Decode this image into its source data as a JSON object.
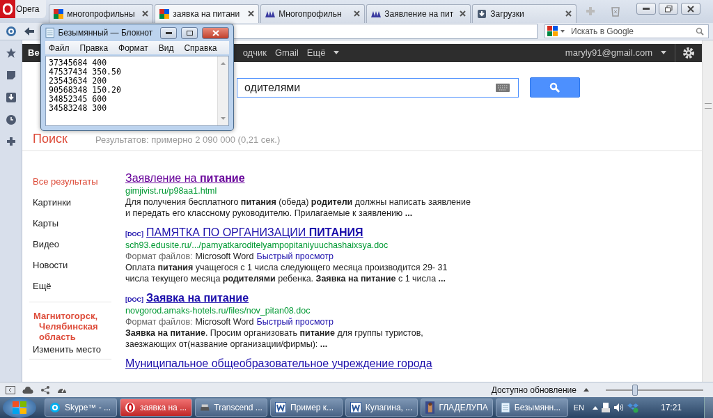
{
  "browser": {
    "menu_button": "Opera",
    "search_placeholder": "Искать в Google",
    "tabs": [
      {
        "title": "многопрофильны",
        "selected": false
      },
      {
        "title": "заявка на питани",
        "selected": true
      },
      {
        "title": "Многопрофильн",
        "selected": false
      },
      {
        "title": "Заявление на пит",
        "selected": false
      },
      {
        "title": "Загрузки",
        "selected": false
      }
    ]
  },
  "google_bar": {
    "links": [
      "Ве",
      "одчик",
      "Gmail",
      "Ещё"
    ],
    "account": "maryly91@gmail.com"
  },
  "search": {
    "value": "одителями"
  },
  "results_header": {
    "title": "Поиск",
    "stats": "Результатов: примерно 2 090 000 (0,21 сек.)"
  },
  "nav": {
    "items": [
      {
        "label": "Все результаты",
        "selected": true
      },
      {
        "label": "Картинки",
        "selected": false
      },
      {
        "label": "Карты",
        "selected": false
      },
      {
        "label": "Видео",
        "selected": false
      },
      {
        "label": "Новости",
        "selected": false
      },
      {
        "label": "Ещё",
        "selected": false
      }
    ],
    "location": "Магнитогорск, Челябинская область",
    "change_location": "Изменить место"
  },
  "results": [
    {
      "title": "Заявление на **питание**",
      "visited": true,
      "url": "gimjivist.ru/p98aa1.html",
      "snippet": "Для получения бесплатного **питания** (обеда) **родители** должны написать заявление и передать его классному руководителю. Прилагаемые к заявлению **...**"
    },
    {
      "tag": "[DOC]",
      "title": "ПАМЯТКА ПО ОРГАНИЗАЦИИ **ПИТАНИЯ**",
      "visited": false,
      "url": "sch93.edusite.ru/.../pamyatkaroditelyampopitaniyuuchashaixsya.doc",
      "meta_label": "Формат файлов:",
      "meta_value": "Microsoft Word",
      "meta_link": "Быстрый просмотр",
      "snippet": "Оплата **питания** учащегося с 1 числа следующего месяца производится 29- 31 числа текущего месяца **родителями** ребенка. **Заявка на питание** с 1 числа **...**"
    },
    {
      "tag": "[DOC]",
      "title": "**Заявка на питание**",
      "visited": false,
      "url": "novgorod.amaks-hotels.ru/files/nov_pitan08.doc",
      "meta_label": "Формат файлов:",
      "meta_value": "Microsoft Word",
      "meta_link": "Быстрый просмотр",
      "snippet": "**Заявка на питание**. Просим организовать **питание** для группы туристов, заезжающих от(название организации/фирмы): **...**"
    },
    {
      "title": "Муниципальное общеобразовательное учреждение города",
      "visited": false
    }
  ],
  "status_bar": {
    "text": "Доступно обновление",
    "zoom": {
      "level": 0.3
    }
  },
  "taskbar": {
    "items": [
      {
        "label": "Skype™ - ...",
        "selected": false
      },
      {
        "label": "заявка на ...",
        "selected": true
      },
      {
        "label": "Transcend ...",
        "selected": false
      },
      {
        "label": "Пример к...",
        "selected": false
      },
      {
        "label": "Кулагина, ...",
        "selected": false
      },
      {
        "label": "ГЛАДЕЛУПА",
        "selected": false
      },
      {
        "label": "Безымянн...",
        "selected": false
      }
    ],
    "lang": "EN",
    "time": "17:21"
  },
  "notepad": {
    "title": "Безымянный — Блокнот",
    "menu": [
      "Файл",
      "Правка",
      "Формат",
      "Вид",
      "Справка"
    ],
    "lines": [
      "37345684 400",
      "47537434 350.50",
      "23543634 200",
      "90568348 150.20",
      "34852345 600",
      "34583248 300"
    ]
  }
}
